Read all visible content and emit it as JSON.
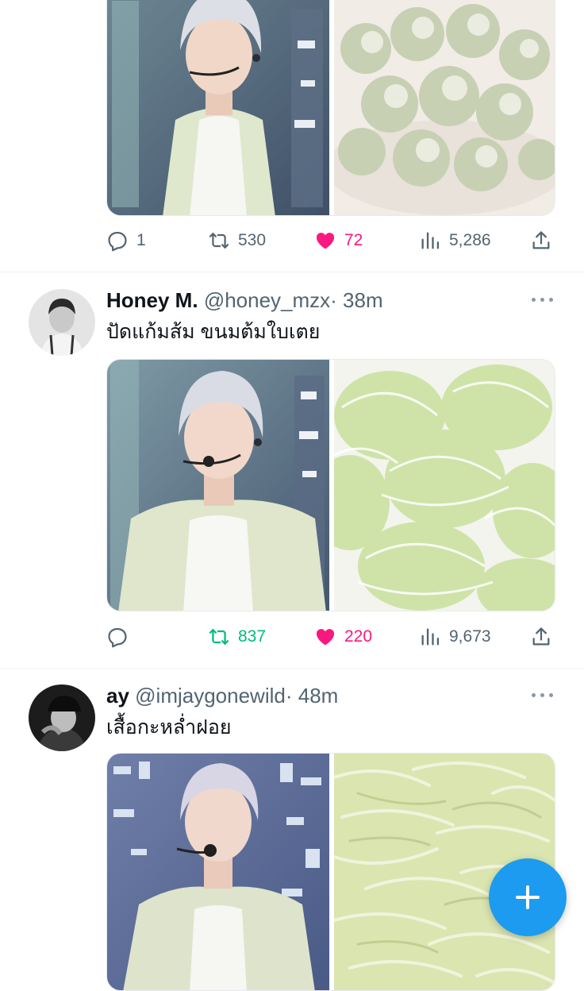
{
  "tweets": [
    {
      "actions": {
        "replies": "1",
        "retweets": "530",
        "likes": "72",
        "views": "5,286"
      }
    },
    {
      "name": "Honey M.",
      "handle": "@honey_mzx",
      "time": "· 38m",
      "text": "ปัดแก้มส้ม ขนมต้มใบเตย",
      "actions": {
        "replies": "",
        "retweets": "837",
        "likes": "220",
        "views": "9,673"
      }
    },
    {
      "name": "ay",
      "handle": "@imjaygonewild",
      "time": "· 48m",
      "text": "เสื้อกะหล่ำฝอย"
    }
  ],
  "colors": {
    "accent": "#1d9bf0",
    "retweet_active": "#00ba7c",
    "like_active": "#f91880",
    "muted": "#536471"
  },
  "icons": [
    "reply-icon",
    "retweet-icon",
    "like-icon",
    "views-icon",
    "share-icon",
    "more-icon",
    "compose-icon"
  ]
}
